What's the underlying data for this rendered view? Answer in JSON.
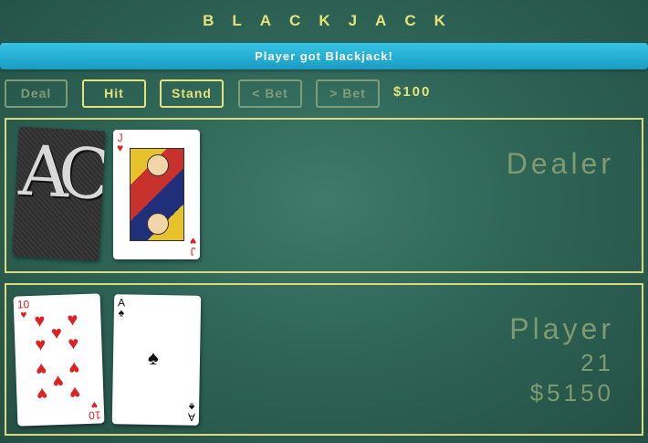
{
  "title": "BLACKJACK",
  "banner": "Player got Blackjack!",
  "buttons": {
    "deal": "Deal",
    "hit": "Hit",
    "stand": "Stand",
    "decrease_bet": "< Bet",
    "increase_bet": "> Bet"
  },
  "bet": "$100",
  "dealer": {
    "label": "Dealer",
    "cards": [
      {
        "face_down": true,
        "back_text": "AC"
      },
      {
        "rank": "J",
        "suit": "♥",
        "suit_name": "hearts"
      }
    ]
  },
  "player": {
    "label": "Player",
    "score": "21",
    "bankroll": "$5150",
    "cards": [
      {
        "rank": "10",
        "suit": "♥",
        "suit_name": "hearts"
      },
      {
        "rank": "A",
        "suit": "♠",
        "suit_name": "spades"
      }
    ]
  },
  "colors": {
    "felt": "#2e6556",
    "accent": "#e6e27a",
    "banner": "#27b2d8",
    "disabled": "#7f9c7a"
  }
}
